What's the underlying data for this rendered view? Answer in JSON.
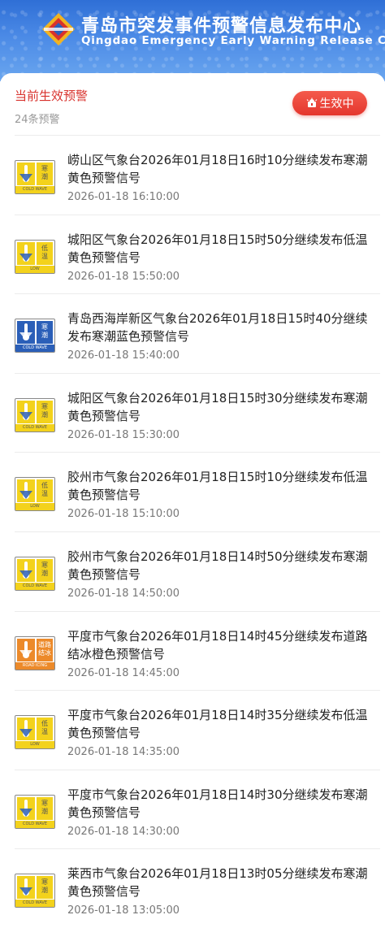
{
  "banner": {
    "title": "青岛市突发事件预警信息发布中心",
    "subtitle": "Qingdao Emergency Early Warning Release Center"
  },
  "header": {
    "title": "当前生效预警",
    "count": "24条预警",
    "active_label": "生效中"
  },
  "colors": {
    "accent_red": "#d8322d",
    "yellow": "#f3d21c",
    "blue": "#2b5fb8",
    "orange": "#ec8a2a"
  },
  "warnings": [
    {
      "title": "崂山区气象台2026年01月18日16时10分继续发布寒潮黄色预警信号",
      "time": "2026-01-18 16:10:00",
      "icon": "cold-wave-yellow-icon",
      "color": "yellow",
      "sign": "寒\n潮",
      "code": "COLD WAVE"
    },
    {
      "title": "城阳区气象台2026年01月18日15时50分继续发布低温黄色预警信号",
      "time": "2026-01-18 15:50:00",
      "icon": "low-temperature-yellow-icon",
      "color": "yellow",
      "sign": "低\n温",
      "code": "LOW"
    },
    {
      "title": "青岛西海岸新区气象台2026年01月18日15时40分继续发布寒潮蓝色预警信号",
      "time": "2026-01-18 15:40:00",
      "icon": "cold-wave-blue-icon",
      "color": "blue",
      "sign": "寒\n潮",
      "code": "COLD WAVE"
    },
    {
      "title": "城阳区气象台2026年01月18日15时30分继续发布寒潮黄色预警信号",
      "time": "2026-01-18 15:30:00",
      "icon": "cold-wave-yellow-icon",
      "color": "yellow",
      "sign": "寒\n潮",
      "code": "COLD WAVE"
    },
    {
      "title": "胶州市气象台2026年01月18日15时10分继续发布低温黄色预警信号",
      "time": "2026-01-18 15:10:00",
      "icon": "low-temperature-yellow-icon",
      "color": "yellow",
      "sign": "低\n温",
      "code": "LOW"
    },
    {
      "title": "胶州市气象台2026年01月18日14时50分继续发布寒潮黄色预警信号",
      "time": "2026-01-18 14:50:00",
      "icon": "cold-wave-yellow-icon",
      "color": "yellow",
      "sign": "寒\n潮",
      "code": "COLD WAVE"
    },
    {
      "title": "平度市气象台2026年01月18日14时45分继续发布道路结冰橙色预警信号",
      "time": "2026-01-18 14:45:00",
      "icon": "road-icing-orange-icon",
      "color": "orange",
      "sign": "道路\n结冰",
      "code": "ROAD ICING"
    },
    {
      "title": "平度市气象台2026年01月18日14时35分继续发布低温黄色预警信号",
      "time": "2026-01-18 14:35:00",
      "icon": "low-temperature-yellow-icon",
      "color": "yellow",
      "sign": "低\n温",
      "code": "LOW"
    },
    {
      "title": "平度市气象台2026年01月18日14时30分继续发布寒潮黄色预警信号",
      "time": "2026-01-18 14:30:00",
      "icon": "cold-wave-yellow-icon",
      "color": "yellow",
      "sign": "寒\n潮",
      "code": "COLD WAVE"
    },
    {
      "title": "莱西市气象台2026年01月18日13时05分继续发布寒潮黄色预警信号",
      "time": "2026-01-18 13:05:00",
      "icon": "cold-wave-yellow-icon",
      "color": "yellow",
      "sign": "寒\n潮",
      "code": "COLD WAVE"
    }
  ]
}
